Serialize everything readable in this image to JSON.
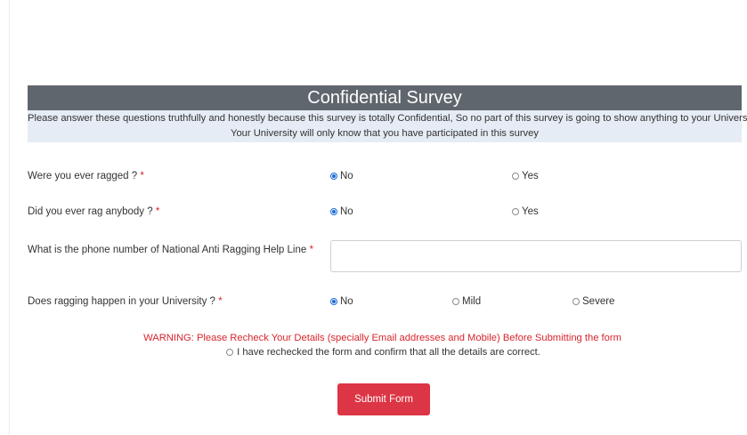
{
  "survey": {
    "title": "Confidential Survey",
    "notice_line1": "Please answer these questions truthfully and honestly because this survey is totally Confidential, So no part of this survey is going to show anything to your University.",
    "notice_line2": "Your University will only know that you have participated in this survey",
    "required_mark": "*"
  },
  "questions": [
    {
      "label": "Were you ever ragged ?",
      "options": [
        {
          "label": "No",
          "selected": true
        },
        {
          "label": "Yes",
          "selected": false
        }
      ]
    },
    {
      "label": "Did you ever rag anybody ?",
      "options": [
        {
          "label": "No",
          "selected": true
        },
        {
          "label": "Yes",
          "selected": false
        }
      ]
    },
    {
      "label": "What is the phone number of National Anti Ragging Help Line",
      "value": "",
      "placeholder": ""
    },
    {
      "label": "Does ragging happen in your University ?",
      "options": [
        {
          "label": "No",
          "selected": true
        },
        {
          "label": "Mild",
          "selected": false
        },
        {
          "label": "Severe",
          "selected": false
        }
      ]
    }
  ],
  "warning": "WARNING: Please Recheck Your Details (specially Email addresses and Mobile) Before Submitting the form",
  "confirm": {
    "label": "I have rechecked the form and confirm that all the details are correct.",
    "selected": false
  },
  "submit_label": "Submit Form",
  "colors": {
    "header_bg": "#5f666d",
    "notice_bg": "#e6ecf5",
    "accent_red": "#dc3545",
    "radio_blue": "#1a6ad8"
  }
}
